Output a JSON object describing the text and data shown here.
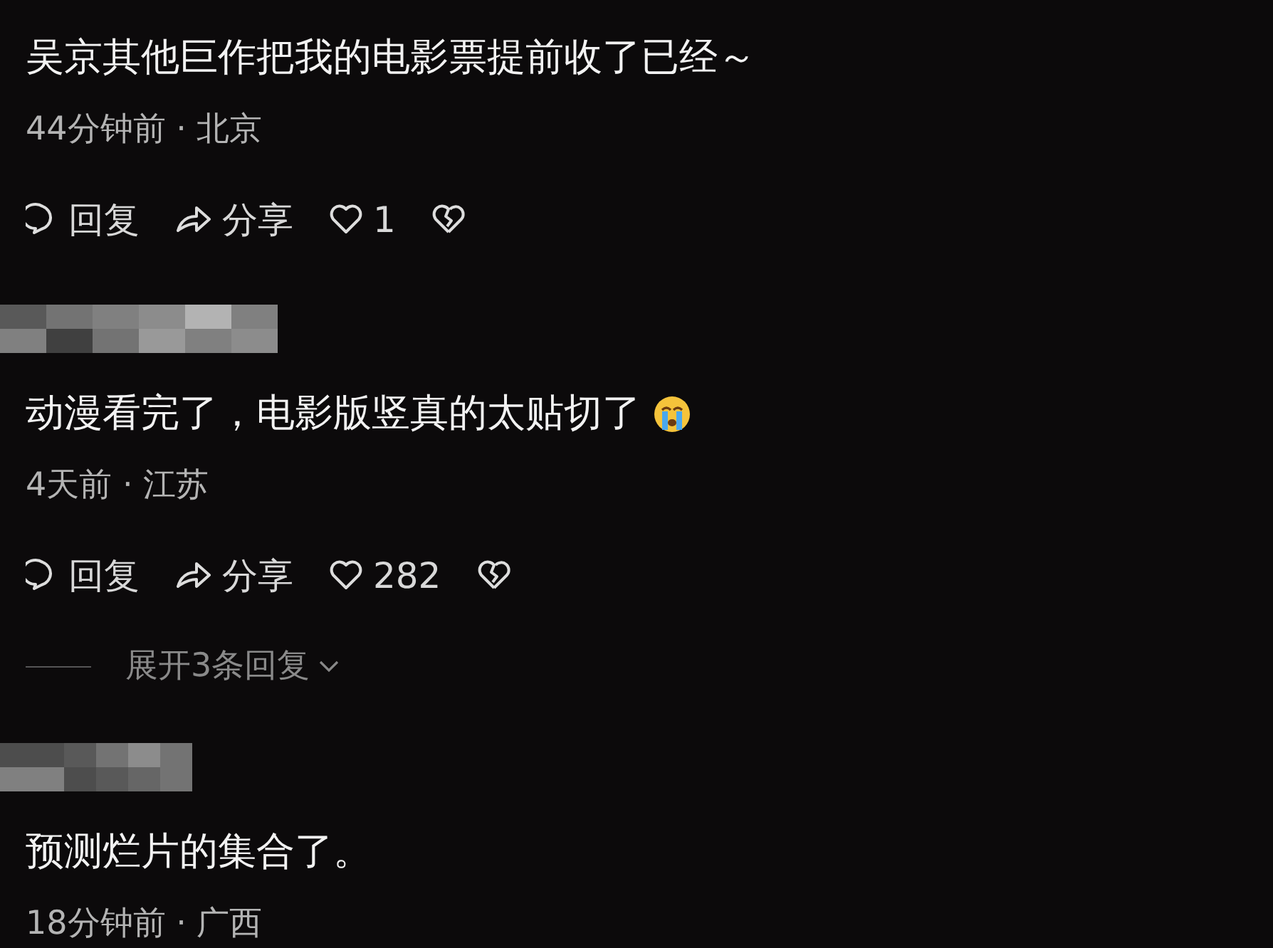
{
  "comments": [
    {
      "author_hidden": false,
      "text": "吴京其他巨作把我的电影票提前收了已经～",
      "emoji": false,
      "meta": "44分钟前 · 北京",
      "actions": {
        "reply": "回复",
        "share": "分享",
        "likes": "1"
      }
    },
    {
      "author_hidden": true,
      "text": "动漫看完了，电影版竖真的太贴切了",
      "emoji": true,
      "meta": "4天前 · 江苏",
      "actions": {
        "reply": "回复",
        "share": "分享",
        "likes": "282"
      },
      "expand_replies": "展开3条回复"
    },
    {
      "author_hidden": true,
      "text": "预测烂片的集合了。",
      "emoji": false,
      "meta": "18分钟前 · 广西"
    }
  ]
}
